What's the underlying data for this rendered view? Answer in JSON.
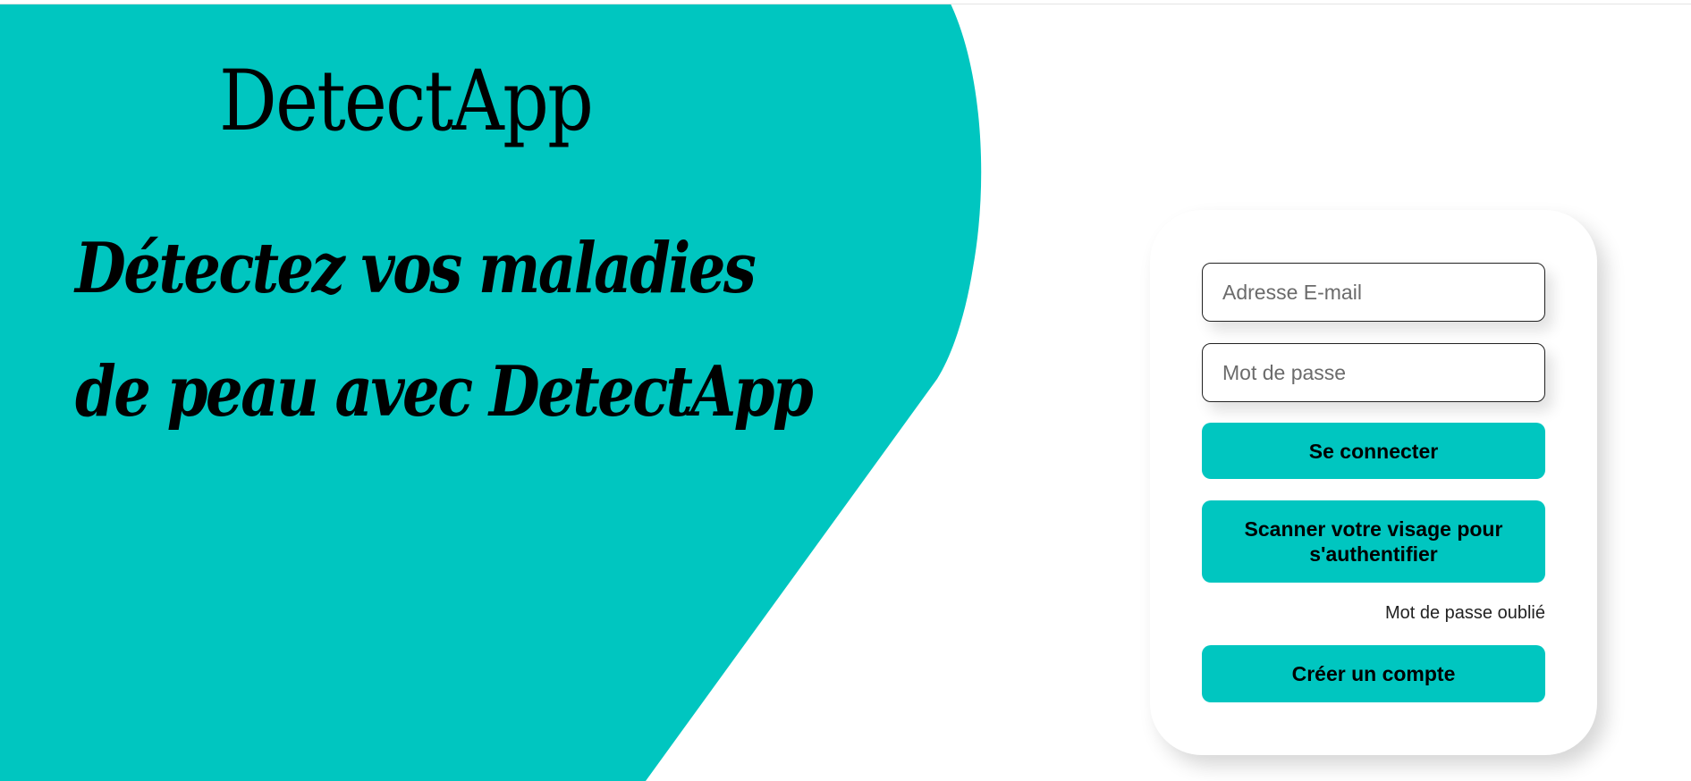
{
  "theme": {
    "accent_color": "#00c6c0",
    "background_color": "#ffffff",
    "text_color": "#000000"
  },
  "brand": {
    "name": "DetectApp"
  },
  "hero": {
    "heading": "Détectez vos maladies de peau avec DetectApp"
  },
  "login_form": {
    "email_placeholder": "Adresse E-mail",
    "email_value": "",
    "password_placeholder": "Mot de passe",
    "password_value": "",
    "login_button_label": "Se connecter",
    "face_scan_button_label": "Scanner votre visage pour s'authentifier",
    "forgot_password_label": "Mot de passe oublié",
    "create_account_button_label": "Créer un compte"
  }
}
